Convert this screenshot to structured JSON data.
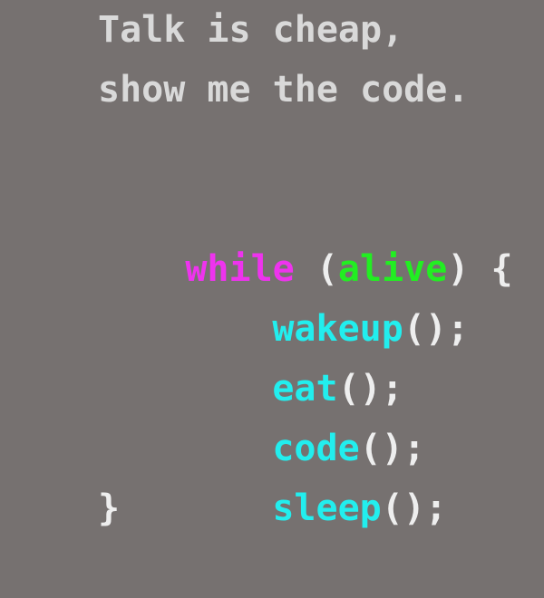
{
  "quote": {
    "line1": "Talk is cheap,",
    "line2": "show me the code."
  },
  "code": {
    "keyword": "while",
    "open_paren": " (",
    "condition": "alive",
    "close_paren_brace": ") {",
    "statements": [
      {
        "name": "wakeup",
        "punc": "();"
      },
      {
        "name": "eat",
        "punc": "();"
      },
      {
        "name": "code",
        "punc": "();"
      },
      {
        "name": "sleep",
        "punc": "();"
      }
    ],
    "closing_brace": "}"
  },
  "colors": {
    "background": "#767170",
    "quote_text": "#d9d9d9",
    "keyword": "#ee33ee",
    "condition": "#22ee22",
    "function": "#22eeee",
    "punctuation": "#eeeeee"
  }
}
